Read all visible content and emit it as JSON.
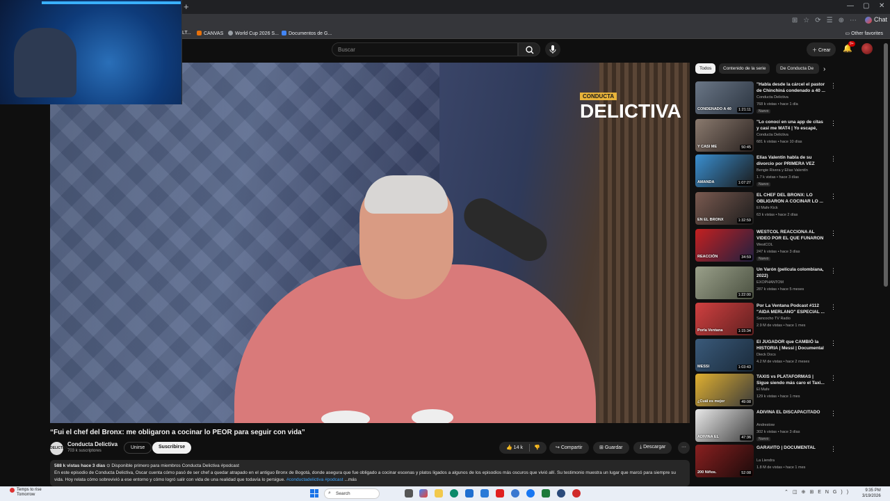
{
  "browser": {
    "bookmarks": [
      {
        "label": "CANVAS",
        "color": "#e8710a"
      },
      {
        "label": "World Cup 2026 S...",
        "color": "#9aa0a6"
      },
      {
        "label": "Documentos de G...",
        "color": "#4285f4"
      }
    ],
    "bookmark_partial": "LT...",
    "other_favorites": "Other favorites",
    "chat_label": "Chat"
  },
  "header": {
    "search_placeholder": "Buscar",
    "create_label": "Crear",
    "notifications_badge": "9+"
  },
  "video": {
    "brand_small": "CONDUCTA",
    "brand_big": "DELICTIVA",
    "title": "“Fui el chef del Bronx: me obligaron a cocinar lo PEOR para seguir con vida”",
    "channel_name": "Conducta Delictiva",
    "channel_avatar_text": "DELICTIVA",
    "subscribers": "703 k suscriptores",
    "join_label": "Unirse",
    "subscribe_label": "Suscribirse",
    "likes": "14 k",
    "share_label": "Compartir",
    "save_label": "Guardar",
    "download_label": "Descargar",
    "more_label": "···"
  },
  "description": {
    "meta": "588 k vistas  hace 3 días",
    "meta_extra": " ⊙ Disponible primero para miembros  Conducta Delictiva #podcast",
    "text": "En este episodio de Conducta Delictiva, Oscar cuenta cómo pasó de ser chef a quedar atrapado en el antiguo Bronx de Bogotá, donde asegura que fue obligado a cocinar escenas y platos ligados a algunos de los episodios más oscuros que vivió allí. Su testimonio muestra un lugar que marcó para siempre su vida. Hoy relata cómo sobrevivió a ese entorno y cómo logró salir con vida de una realidad que todavía lo persigue.",
    "tags": " #conductadelictiva #podcast",
    "more": " ...más"
  },
  "sidebar": {
    "chips": [
      "Todos",
      "Contenido de la serie",
      "De Conducta De"
    ],
    "recommendations": [
      {
        "title": "\"Habla desde la cárcel el pastor de Chinchiná condenado a 40 ...",
        "channel": "Conducta Delictiva",
        "meta": "768 k vistas • hace 1 día",
        "duration": "1:21:11",
        "badge": "Nuevo",
        "caption": "CONDENADO A 40",
        "color1": "#6a7686",
        "color2": "#2b3440"
      },
      {
        "title": "\"Lo conocí en una app de citas y casi me MAT4 | Yo escapé, per...",
        "channel": "Conducta Delictiva",
        "meta": "681 k vistas • hace 10 días",
        "duration": "50:45",
        "badge": "",
        "caption": "Y CASI ME",
        "color1": "#8a7a6e",
        "color2": "#2a2220"
      },
      {
        "title": "Elías Valentín habla de su divorcio por PRIMERA VEZ",
        "channel": "Bengie Rivera y Elías Valentín",
        "meta": "1.7 k vistas • hace 3 días",
        "duration": "1:07:27",
        "badge": "Nuevo",
        "caption": "AMANDA",
        "color1": "#3a8fd0",
        "color2": "#1a1a1a"
      },
      {
        "title": "EL CHEF DEL BRONX: LO OBLIGARON A COCINAR LO ...",
        "channel": "El Mafe Kick",
        "meta": "63 k vistas • hace 2 días",
        "duration": "1:32:59",
        "badge": "",
        "caption": "EN EL BRONX",
        "color1": "#7a5a50",
        "color2": "#1c1c1c"
      },
      {
        "title": "WESTCOL REACCIONA AL VIDEO POR EL QUE FUNARON ...",
        "channel": "WestCOL",
        "meta": "247 k vistas • hace 3 días",
        "duration": "34:59",
        "badge": "Nuevo",
        "caption": "REACCIÓN",
        "color1": "#c42020",
        "color2": "#202040"
      },
      {
        "title": "Un Varón (película colombiana, 2022)",
        "channel": "EXOPHANTOM",
        "meta": "287 k vistas • hace 5 meses",
        "duration": "1:22:00",
        "badge": "",
        "caption": "",
        "color1": "#9aa08a",
        "color2": "#4a5040"
      },
      {
        "title": "Por La Ventana Podcast #112 \"AIDA MERLANO\" ESPECIAL ...",
        "channel": "Sancocho TV Radio",
        "meta": "2.9 M de vistas • hace 1 mes",
        "duration": "1:15:34",
        "badge": "",
        "caption": "Porla Ventana",
        "color1": "#d04040",
        "color2": "#602020"
      },
      {
        "title": "El JUGADOR que CAMBIÓ la HISTORIA | Messi | Documental",
        "channel": "Dieck Docs",
        "meta": "4.2 M de vistas • hace 2 meses",
        "duration": "1:03:43",
        "badge": "",
        "caption": "MESSI",
        "color1": "#3a5a7a",
        "color2": "#1a2a3a"
      },
      {
        "title": "TAXIS vs PLATAFORMAS | Sigue siendo más caro el Taxi...",
        "channel": "El Mafe",
        "meta": "129 k vistas • hace 1 mes",
        "duration": "49:08",
        "badge": "",
        "caption": "¿Cuál es mejor",
        "color1": "#e0b030",
        "color2": "#3a3a3a"
      },
      {
        "title": "ADIVINA EL DISCAPACITADO",
        "channel": "Andrestow",
        "meta": "302 k vistas • hace 3 días",
        "duration": "47:36",
        "badge": "Nuevo",
        "caption": "ADIVINA EL",
        "color1": "#e8e8e8",
        "color2": "#404040"
      },
      {
        "title": "GARAVITO | DOCUMENTAL",
        "channel": "La Liendra",
        "meta": "1.8 M de vistas • hace 1 mes",
        "duration": "52:08",
        "badge": "",
        "caption": "200 Niños.",
        "color1": "#8a2020",
        "color2": "#1a0a0a"
      }
    ]
  },
  "taskbar": {
    "weather_title": "Temps to rise",
    "weather_sub": "Tomorrow",
    "search_label": "Search",
    "time": "9:35 PM",
    "date": "3/19/2026"
  }
}
